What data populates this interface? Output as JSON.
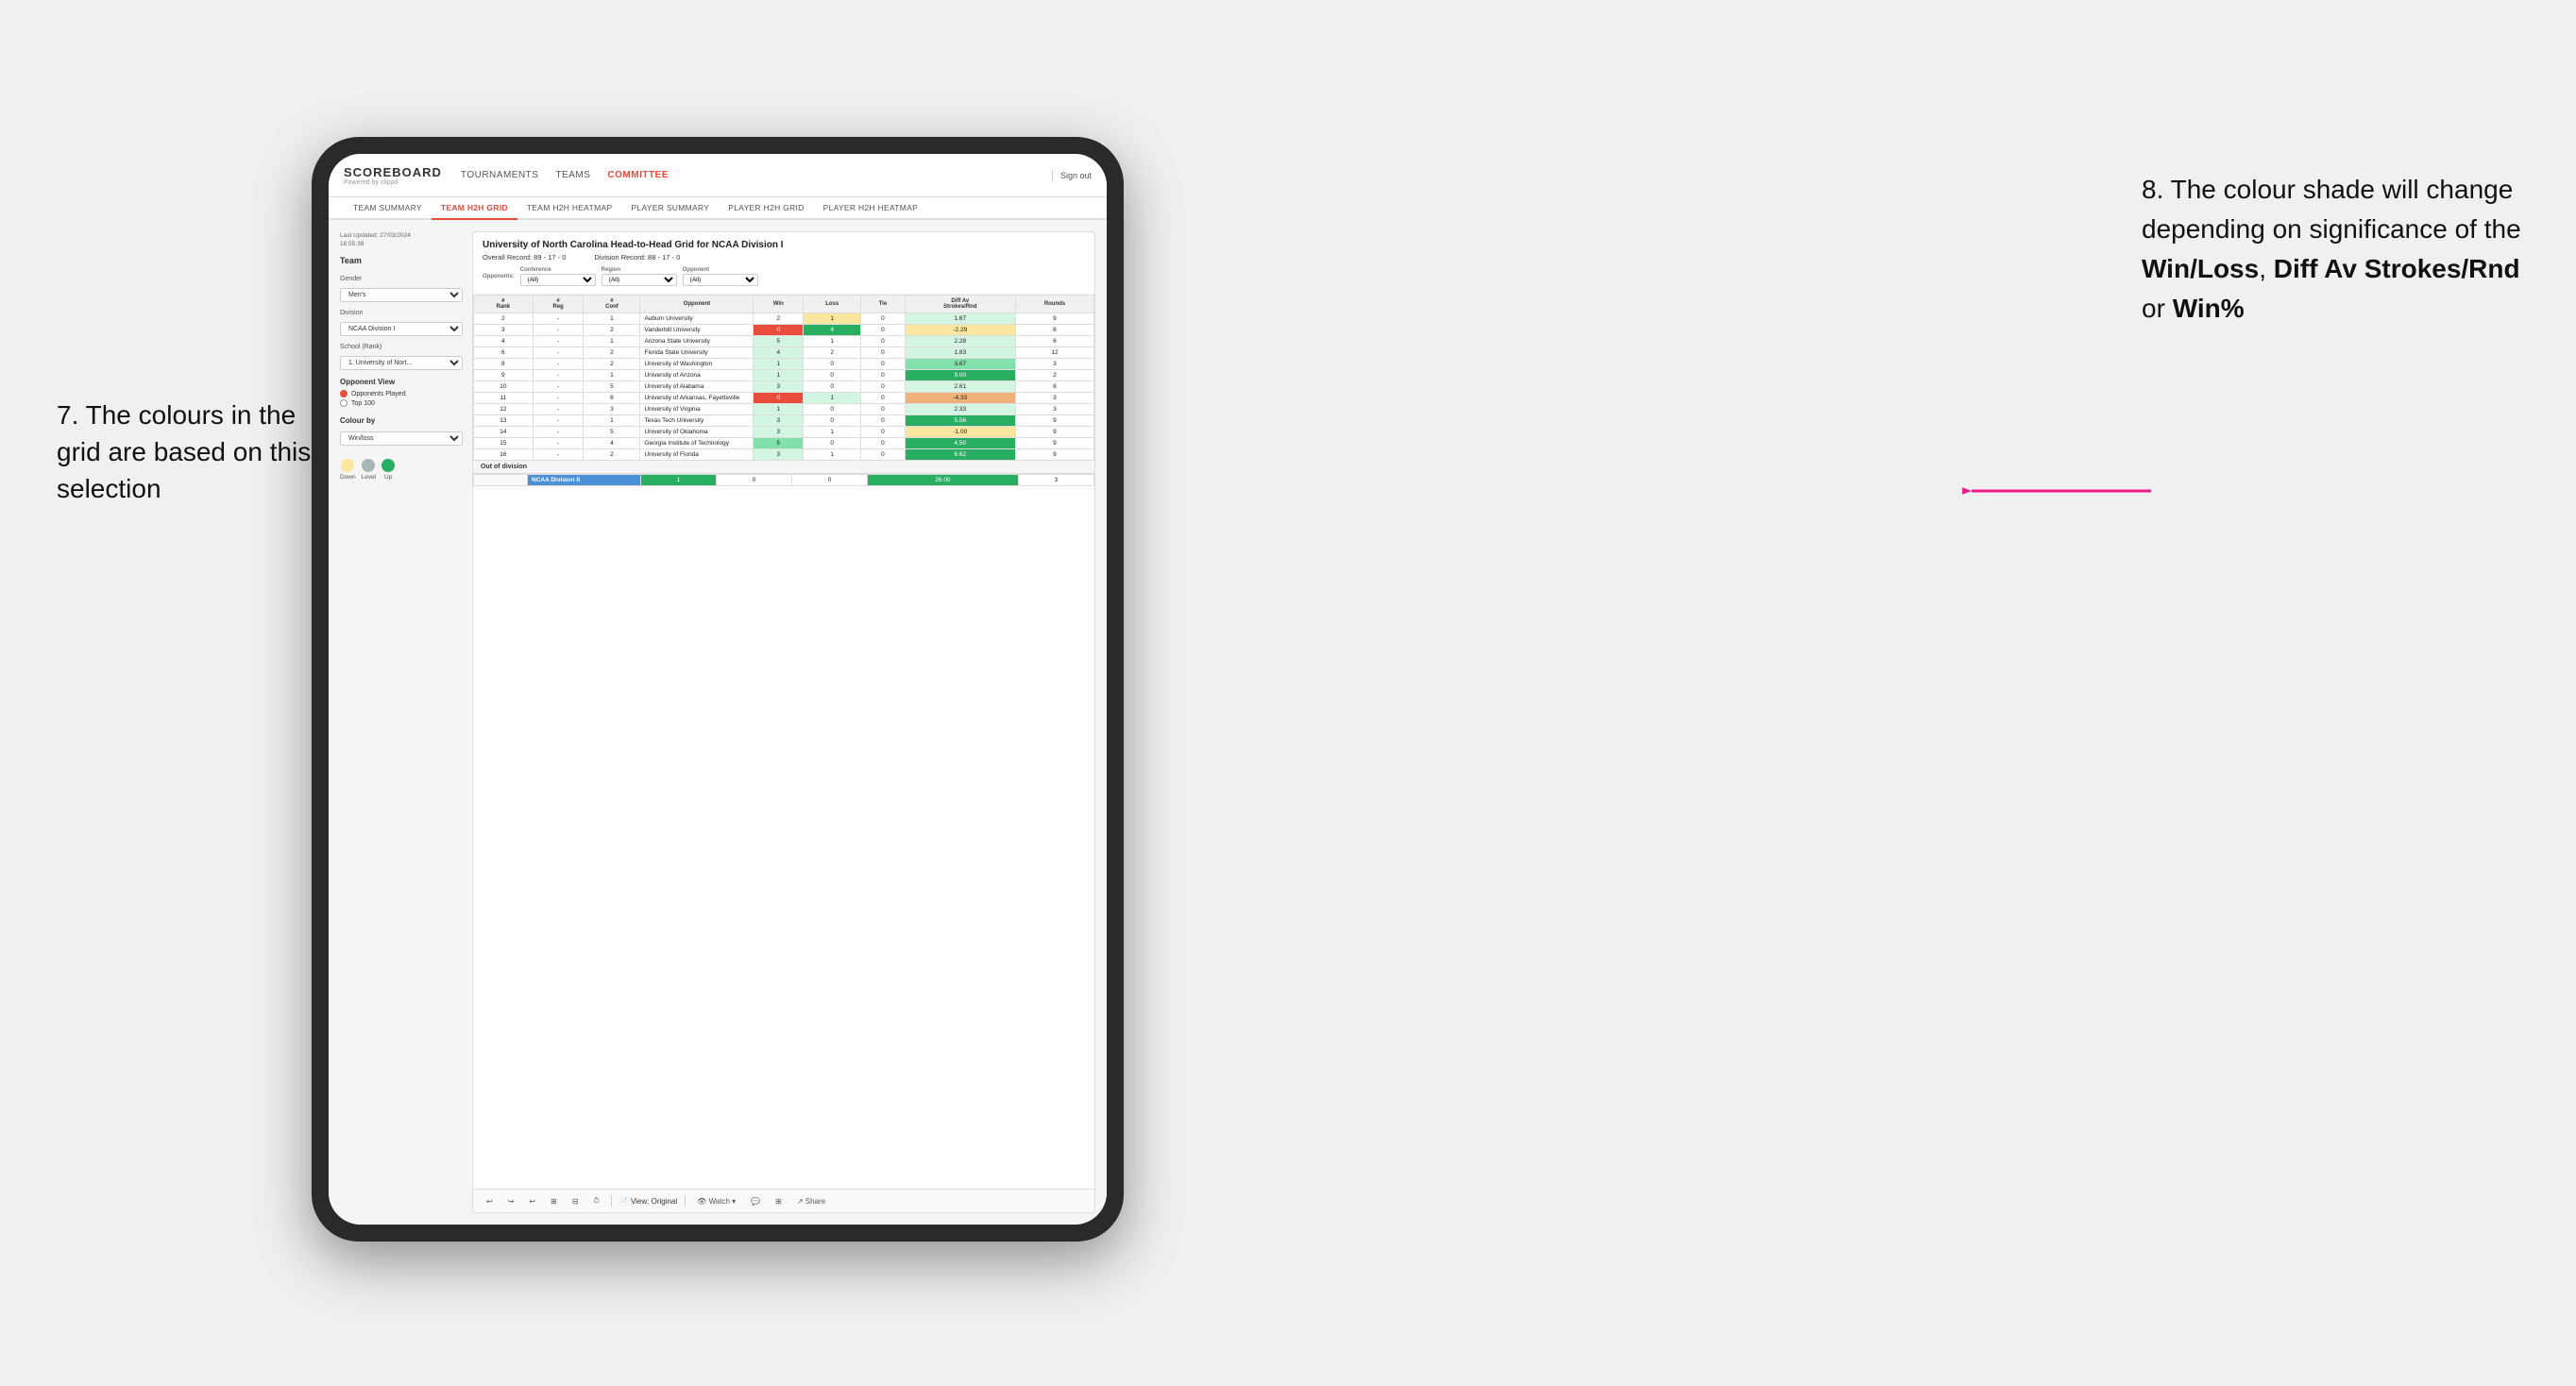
{
  "annotation": {
    "left_title": "7. The colours in the grid are based on this selection",
    "right_title": "8. The colour shade will change depending on significance of the ",
    "right_bold1": "Win/Loss",
    "right_comma1": ", ",
    "right_bold2": "Diff Av Strokes/Rnd",
    "right_or": " or ",
    "right_bold3": "Win%"
  },
  "nav": {
    "logo": "SCOREBOARD",
    "logo_sub": "Powered by clippd",
    "links": [
      "TOURNAMENTS",
      "TEAMS",
      "COMMITTEE"
    ],
    "sign_out": "Sign out"
  },
  "sub_nav": {
    "links": [
      "TEAM SUMMARY",
      "TEAM H2H GRID",
      "TEAM H2H HEATMAP",
      "PLAYER SUMMARY",
      "PLAYER H2H GRID",
      "PLAYER H2H HEATMAP"
    ],
    "active": "TEAM H2H GRID"
  },
  "left_panel": {
    "last_updated_label": "Last Updated: 27/03/2024",
    "last_updated_time": "16:55:38",
    "team_section": "Team",
    "gender_label": "Gender",
    "gender_value": "Men's",
    "division_label": "Division",
    "division_value": "NCAA Division I",
    "school_label": "School (Rank)",
    "school_value": "1. University of Nort...",
    "opponent_view_title": "Opponent View",
    "radio_options": [
      "Opponents Played",
      "Top 100"
    ],
    "radio_selected": "Opponents Played",
    "colour_by_label": "Colour by",
    "colour_by_value": "Win/loss",
    "legend": {
      "down_label": "Down",
      "level_label": "Level",
      "up_label": "Up",
      "down_color": "#f9e79f",
      "level_color": "#aab7b8",
      "up_color": "#27ae60"
    }
  },
  "grid": {
    "title": "University of North Carolina Head-to-Head Grid for NCAA Division I",
    "overall_record": "Overall Record: 89 - 17 - 0",
    "division_record": "Division Record: 88 - 17 - 0",
    "filters": {
      "conference_label": "Conference",
      "conference_value": "(All)",
      "region_label": "Region",
      "region_value": "(All)",
      "opponent_label": "Opponent",
      "opponent_value": "(All)",
      "opponents_label": "Opponents:",
      "opponents_value": "(All)"
    },
    "columns": [
      "#\nRank",
      "#\nReg",
      "#\nConf",
      "Opponent",
      "Win",
      "Loss",
      "Tie",
      "Diff Av\nStrokes/Rnd",
      "Rounds"
    ],
    "rows": [
      {
        "rank": "2",
        "reg": "-",
        "conf": "1",
        "opponent": "Auburn University",
        "win": "2",
        "loss": "1",
        "tie": "0",
        "diff": "1.67",
        "rounds": "9",
        "win_color": "white",
        "loss_color": "yellow",
        "diff_color": "green-light"
      },
      {
        "rank": "3",
        "reg": "-",
        "conf": "2",
        "opponent": "Vanderbilt University",
        "win": "0",
        "loss": "4",
        "tie": "0",
        "diff": "-2.29",
        "rounds": "8",
        "win_color": "red",
        "loss_color": "green-dark",
        "diff_color": "yellow"
      },
      {
        "rank": "4",
        "reg": "-",
        "conf": "1",
        "opponent": "Arizona State University",
        "win": "5",
        "loss": "1",
        "tie": "0",
        "diff": "2.28",
        "rounds": "6",
        "win_color": "green-light",
        "loss_color": "white",
        "diff_color": "green-light"
      },
      {
        "rank": "6",
        "reg": "-",
        "conf": "2",
        "opponent": "Florida State University",
        "win": "4",
        "loss": "2",
        "tie": "0",
        "diff": "1.83",
        "rounds": "12",
        "win_color": "green-light",
        "loss_color": "white",
        "diff_color": "green-light"
      },
      {
        "rank": "8",
        "reg": "-",
        "conf": "2",
        "opponent": "University of Washington",
        "win": "1",
        "loss": "0",
        "tie": "0",
        "diff": "3.67",
        "rounds": "3",
        "win_color": "green-light",
        "loss_color": "white",
        "diff_color": "green-med"
      },
      {
        "rank": "9",
        "reg": "-",
        "conf": "1",
        "opponent": "University of Arizona",
        "win": "1",
        "loss": "0",
        "tie": "0",
        "diff": "9.00",
        "rounds": "2",
        "win_color": "green-light",
        "loss_color": "white",
        "diff_color": "green-dark"
      },
      {
        "rank": "10",
        "reg": "-",
        "conf": "5",
        "opponent": "University of Alabama",
        "win": "3",
        "loss": "0",
        "tie": "0",
        "diff": "2.61",
        "rounds": "8",
        "win_color": "green-light",
        "loss_color": "white",
        "diff_color": "green-light"
      },
      {
        "rank": "11",
        "reg": "-",
        "conf": "6",
        "opponent": "University of Arkansas, Fayetteville",
        "win": "0",
        "loss": "1",
        "tie": "0",
        "diff": "-4.33",
        "rounds": "3",
        "win_color": "red",
        "loss_color": "green-light",
        "diff_color": "orange"
      },
      {
        "rank": "12",
        "reg": "-",
        "conf": "3",
        "opponent": "University of Virginia",
        "win": "1",
        "loss": "0",
        "tie": "0",
        "diff": "2.33",
        "rounds": "3",
        "win_color": "green-light",
        "loss_color": "white",
        "diff_color": "green-light"
      },
      {
        "rank": "13",
        "reg": "-",
        "conf": "1",
        "opponent": "Texas Tech University",
        "win": "3",
        "loss": "0",
        "tie": "0",
        "diff": "5.56",
        "rounds": "9",
        "win_color": "green-light",
        "loss_color": "white",
        "diff_color": "green-dark"
      },
      {
        "rank": "14",
        "reg": "-",
        "conf": "5",
        "opponent": "University of Oklahoma",
        "win": "3",
        "loss": "1",
        "tie": "0",
        "diff": "-1.00",
        "rounds": "9",
        "win_color": "green-light",
        "loss_color": "white",
        "diff_color": "yellow"
      },
      {
        "rank": "15",
        "reg": "-",
        "conf": "4",
        "opponent": "Georgia Institute of Technology",
        "win": "5",
        "loss": "0",
        "tie": "0",
        "diff": "4.50",
        "rounds": "9",
        "win_color": "green-med",
        "loss_color": "white",
        "diff_color": "green-dark"
      },
      {
        "rank": "16",
        "reg": "-",
        "conf": "2",
        "opponent": "University of Florida",
        "win": "3",
        "loss": "1",
        "tie": "0",
        "diff": "6.62",
        "rounds": "9",
        "win_color": "green-light",
        "loss_color": "white",
        "diff_color": "green-dark"
      }
    ],
    "out_of_division_label": "Out of division",
    "out_of_division_rows": [
      {
        "division": "NCAA Division II",
        "win": "1",
        "loss": "0",
        "tie": "0",
        "diff": "26.00",
        "rounds": "3"
      }
    ],
    "toolbar": {
      "view_label": "View: Original",
      "watch_label": "Watch",
      "share_label": "Share"
    }
  }
}
